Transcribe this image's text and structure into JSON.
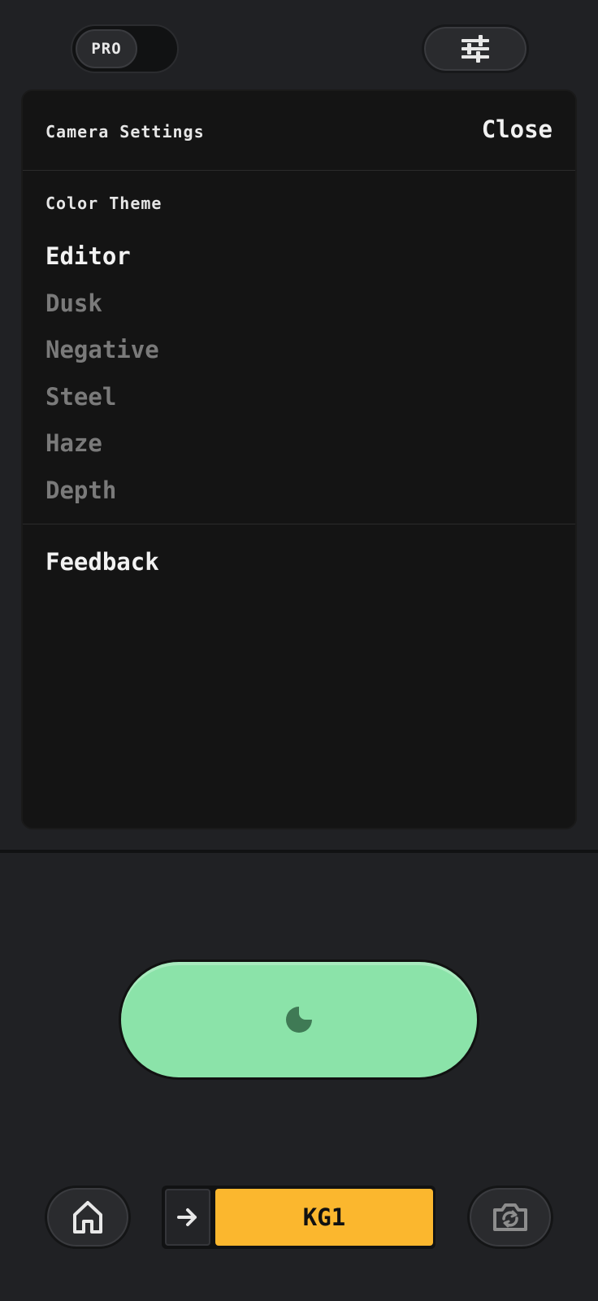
{
  "top_bar": {
    "pro_label": "PRO",
    "settings_icon": "sliders-icon"
  },
  "settings_panel": {
    "title": "Camera Settings",
    "close_label": "Close",
    "color_theme": {
      "label": "Color Theme",
      "selected": "Editor",
      "options": [
        "Editor",
        "Dusk",
        "Negative",
        "Steel",
        "Haze",
        "Depth"
      ]
    },
    "feedback_label": "Feedback"
  },
  "shutter": {
    "icon": "lens-icon",
    "color": "#8be3a9"
  },
  "bottom_bar": {
    "home_icon": "home-icon",
    "arrow_icon": "arrow-right-icon",
    "preset_label": "KG1",
    "preset_color": "#fbb72e",
    "flip_icon": "camera-flip-icon"
  }
}
